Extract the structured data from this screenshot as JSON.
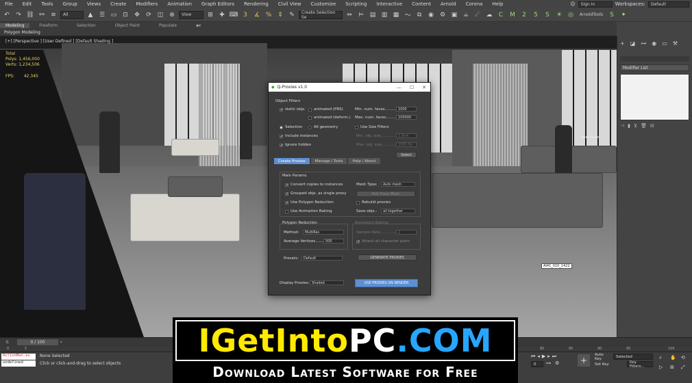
{
  "menu": {
    "items": [
      "File",
      "Edit",
      "Tools",
      "Group",
      "Views",
      "Create",
      "Modifiers",
      "Animation",
      "Graph Editors",
      "Rendering",
      "Civil View",
      "Customize",
      "Scripting",
      "Interactive",
      "Content",
      "Arnold",
      "Corona",
      "Help"
    ],
    "sign_in": "Sign In",
    "workspaces_label": "Workspaces:",
    "workspaces_value": "Default"
  },
  "toolbar": {
    "filter_value": "All",
    "view_value": "View",
    "selection_set_placeholder": "Create Selection Se",
    "arnold_label": "ArnoldTools"
  },
  "ribbon": {
    "tabs": [
      "Modeling",
      "Freeform",
      "Selection",
      "Object Paint",
      "Populate"
    ],
    "active_tab": "Modeling",
    "sub_label": "Polygon Modeling"
  },
  "viewport": {
    "label": "[+] [Perspective ] [User Defined ] [Default Shading ]",
    "stats": [
      "Total",
      "Polys: 1,456,000",
      "Verts: 1,234,506"
    ],
    "fps_label": "FPS:",
    "fps_value": "42.345",
    "object_tag": "AI41_010_1422",
    "plane_tag": "ApexPlane"
  },
  "command_panel": {
    "modifier_list": "Modifier List"
  },
  "dialog": {
    "title": "Q-Proxies v1.0",
    "object_filters": "Object Filters",
    "static_objs": "static objs.",
    "animated_prs": "animated (PRS)",
    "animated_deform": "animated (deform.)",
    "min_faces_label": "Min. num. faces............",
    "min_faces_value": "1000",
    "max_faces_label": "Max. num. faces............",
    "max_faces_value": "100000",
    "selection": "Selection",
    "all_geometry": "All geometry",
    "use_size_filters": "Use Size Filters",
    "include_instances": "Include instances",
    "ignore_hidden": "Ignore hidden",
    "min_obj_size_label": "Min. obj. size............",
    "min_obj_size_value": "1,0cm",
    "max_obj_size_label": "Max. obj. size............",
    "max_obj_size_value": "1000,0cr",
    "select_button": "Select",
    "tabs": [
      "Create Proxies",
      "Manage / Tools",
      "Help / About"
    ],
    "main_params": "Main Params.",
    "convert_copies": "Convert copies to instances",
    "grouped_objs": "Grouped objs. as single proxy",
    "use_polygon_reduction": "Use Polygon Reduction",
    "use_animation_baking": "Use Animation Baking",
    "mesh_type_label": "Mesh Type:",
    "mesh_type_value": "Auto mesh",
    "pick_proxy_mesh": "Pick Proxy Mesh",
    "rebuild_proxies": "Rebuild proxies",
    "save_objs_label": "Save objs.:",
    "save_objs_value": "all together",
    "polygon_reduction": "Polygon Reduction",
    "method_label": "Method:",
    "method_value": "MultiRes",
    "avg_vertices_label": "Average Vertices.......",
    "avg_vertices_value": "500",
    "animation_baking": "Animation Baking",
    "sample_rate_label": "Sample Rate...............",
    "sample_rate_value": "2",
    "attach_char_parts": "Attach all character parts",
    "presets_label": "Presets:",
    "presets_value": "Default",
    "generate_proxies": "GENERATE PROXIES",
    "display_proxies_label": "Display Proxies:",
    "display_proxies_value": "Shaded",
    "use_proxies_render": "USE PROXIES ON RENDER"
  },
  "timeline": {
    "slider": "0 / 100",
    "ticks": [
      "0",
      "5",
      "80",
      "85",
      "90",
      "95",
      "100"
    ]
  },
  "status": {
    "maxscript_1": "ActionMan.ex",
    "maxscript_2": "undefined",
    "selected": "None Selected",
    "hint": "Click or click-and-drag to select objects",
    "auto_key": "Auto Key",
    "set_key": "Set Key",
    "selected_value": "Selected",
    "key_filters": "Key Filters...",
    "frame_value": "0"
  },
  "banner": {
    "part1": "IGetInto",
    "part2": "PC",
    "part3": ".COM",
    "tagline": "Download Latest Software for Free"
  },
  "colors": {
    "accent_blue": "#5e8fd1",
    "banner_yellow": "#ffea00",
    "banner_blue": "#27a6ff"
  }
}
